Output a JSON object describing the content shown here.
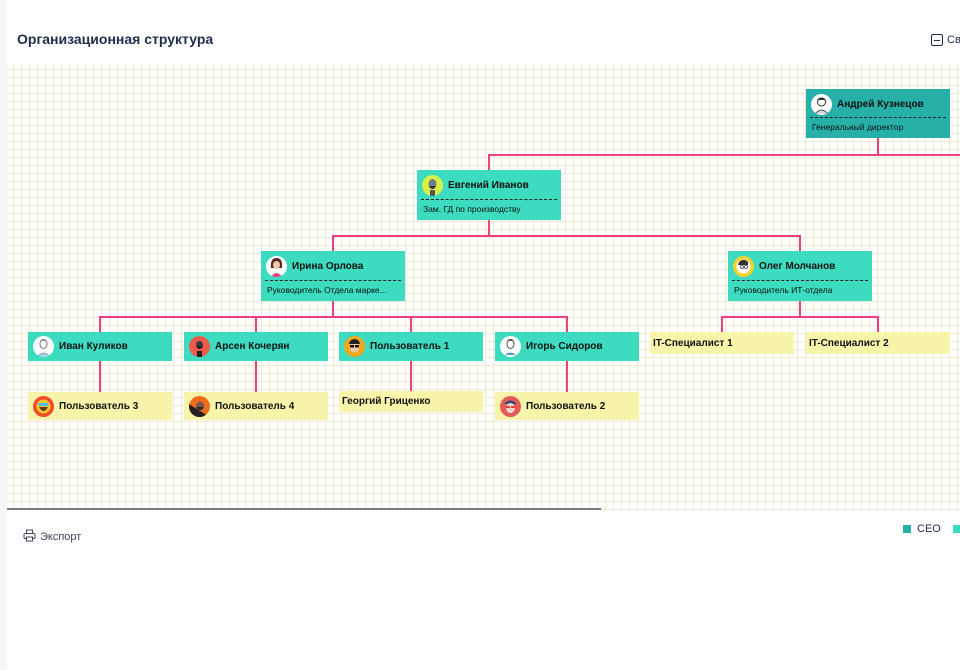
{
  "header": {
    "title": "Организационная структура",
    "collapse_label": "Свернуть"
  },
  "colors": {
    "ceo": "#27b0a8",
    "manager": "#3ddcc0",
    "employee": "#f8f5ab",
    "connector": "#ef3f7f"
  },
  "nodes": {
    "ceo": {
      "name": "Андрей Кузнецов",
      "role": "Генеральный директор",
      "avatar": "man-sketch-avatar"
    },
    "deputy": {
      "name": "Евгений Иванов",
      "role": "Зам. ГД по производству",
      "avatar": "bearded-man-avatar"
    },
    "marketing_head": {
      "name": "Ирина Орлова",
      "role": "Руководитель Отдела марке...",
      "avatar": "woman-avatar"
    },
    "it_head": {
      "name": "Олег Молчанов",
      "role": "Руководитель ИТ-отдела",
      "avatar": "man-glasses-avatar"
    },
    "ivan": {
      "name": "Иван Куликов",
      "avatar": "man-sketch-avatar"
    },
    "arsen": {
      "name": "Арсен Кочерян",
      "avatar": "bearded-man-red-avatar"
    },
    "user1": {
      "name": "Пользователь 1",
      "avatar": "man-sunglasses-avatar"
    },
    "igor": {
      "name": "Игорь Сидоров",
      "avatar": "man-sketch-suit-avatar"
    },
    "it1": {
      "name": "IT-Специалист 1"
    },
    "it2": {
      "name": "IT-Специалист 2"
    },
    "user3": {
      "name": "Пользователь 3",
      "avatar": "bearded-man-goggles-avatar"
    },
    "user4": {
      "name": "Пользователь 4",
      "avatar": "bearded-man-orange-avatar"
    },
    "georgy": {
      "name": "Георгий Гриценко"
    },
    "user2": {
      "name": "Пользователь 2",
      "avatar": "hipster-avatar"
    }
  },
  "footer": {
    "export_label": "Экспорт",
    "legend": [
      {
        "label": "CEO",
        "color": "#27b0a8"
      },
      {
        "label": "",
        "color": "#3ddcc0"
      }
    ]
  }
}
